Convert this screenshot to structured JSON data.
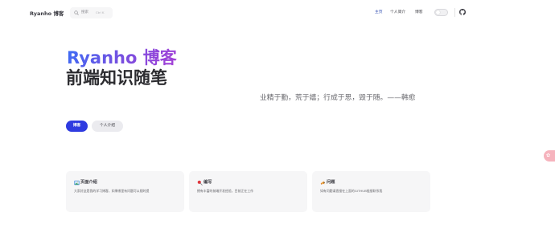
{
  "nav": {
    "brand": "Ryanho 博客",
    "search_label": "搜索",
    "search_shortcut": "Ctrl K",
    "links": [
      "主页",
      "个人简介",
      "博客"
    ],
    "active_color": "#3451b2"
  },
  "hero": {
    "name": "Ryanho 博客",
    "text": "前端知识随笔",
    "tagline": "业精于勤，荒于嬉；行成于思，毁于随。——韩愈",
    "actions": [
      {
        "label": "博客",
        "theme": "brand",
        "color": "#2f3be0"
      },
      {
        "label": "个人介绍",
        "theme": "alt"
      }
    ]
  },
  "features": [
    {
      "icon": "picture-icon",
      "title": "页面介绍",
      "details": "大家好这是我的学习博客，如果哪里有问题可以随时提"
    },
    {
      "icon": "pin-icon",
      "title": "编写",
      "details": "拥有丰富的前端开发经验，目前正在工作"
    },
    {
      "icon": "speaker-icon",
      "title": "问题",
      "details": "如有问题请直接在上面的GITHUB链接联系我"
    }
  ],
  "float_button": {
    "icon": "sakura-icon",
    "color": "#f6b3bd"
  }
}
